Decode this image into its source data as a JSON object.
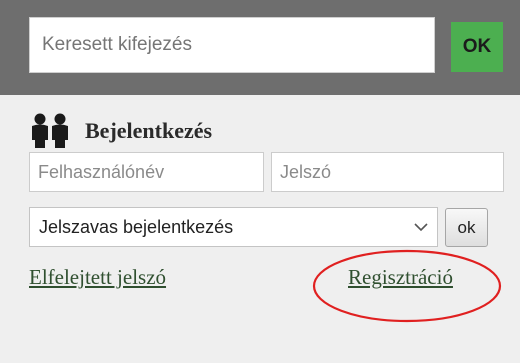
{
  "search": {
    "placeholder": "Keresett kifejezés",
    "button_label": "OK"
  },
  "login": {
    "icon": "users-icon",
    "title": "Bejelentkezés",
    "username_placeholder": "Felhasználónév",
    "password_placeholder": "Jelszó",
    "method_selected": "Jelszavas bejelentkezés",
    "ok_label": "ok",
    "forgot_password_link": "Elfelejtett jelszó",
    "register_link": "Regisztráció"
  },
  "colors": {
    "search_bar_bg": "#6e6e6e",
    "ok_button_green": "#4caf50",
    "panel_bg": "#efefef",
    "highlight_ellipse": "#e02020"
  }
}
